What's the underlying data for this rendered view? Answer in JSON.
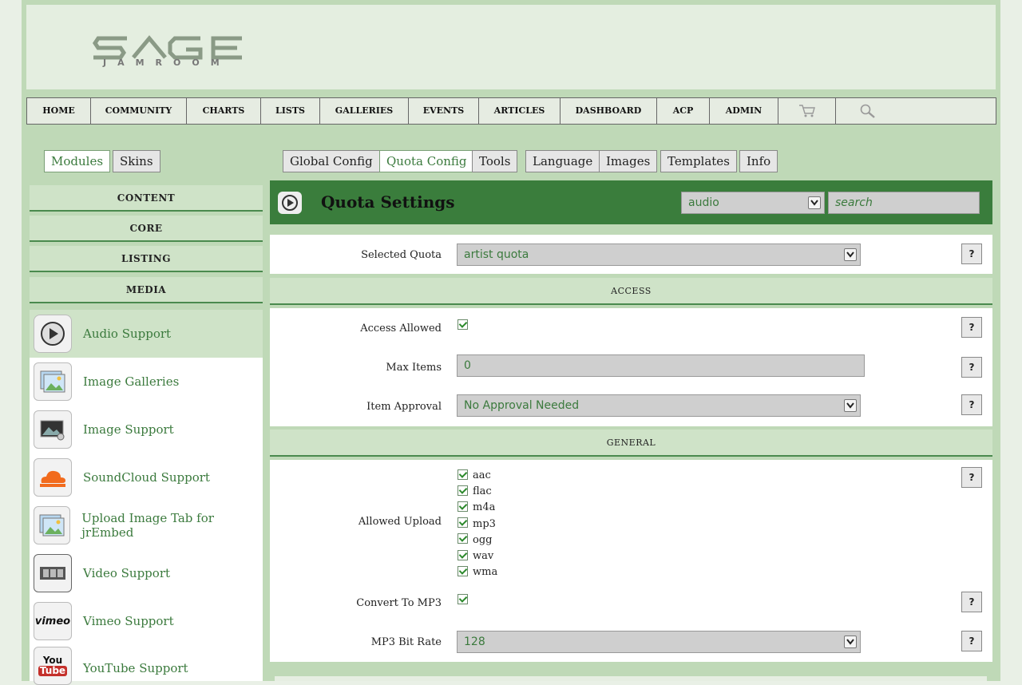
{
  "logo": {
    "text": "SAGE",
    "subtext": "JAMROOM"
  },
  "nav": {
    "items": [
      "HOME",
      "COMMUNITY",
      "CHARTS",
      "LISTS",
      "GALLERIES",
      "EVENTS",
      "ARTICLES",
      "DASHBOARD",
      "ACP",
      "ADMIN"
    ],
    "icons": [
      "cart-icon",
      "search-icon"
    ]
  },
  "sidebar_tabs": {
    "modules": "Modules",
    "skins": "Skins",
    "active": "Modules"
  },
  "main_tabs": {
    "items": [
      "Global Config",
      "Quota Config",
      "Tools",
      "Language",
      "Images",
      "Templates",
      "Info"
    ],
    "active": "Quota Config"
  },
  "sidebar": {
    "categories": [
      "CONTENT",
      "CORE",
      "LISTING",
      "MEDIA"
    ],
    "items": [
      {
        "label": "Audio Support",
        "icon": "play-icon",
        "active": true
      },
      {
        "label": "Image Galleries",
        "icon": "image-gallery-icon"
      },
      {
        "label": "Image Support",
        "icon": "image-support-icon"
      },
      {
        "label": "SoundCloud Support",
        "icon": "soundcloud-icon"
      },
      {
        "label": "Upload Image Tab for jrEmbed",
        "icon": "upload-image-icon"
      },
      {
        "label": "Video Support",
        "icon": "film-icon"
      },
      {
        "label": "Vimeo Support",
        "icon": "vimeo-icon",
        "icon_text": "vimeo"
      },
      {
        "label": "YouTube Support",
        "icon": "youtube-icon",
        "icon_text_top": "You",
        "icon_text_bottom": "Tube"
      }
    ]
  },
  "quota_panel": {
    "title": "Quota Settings",
    "module_select": "audio",
    "search_placeholder": "search",
    "selected_quota_label": "Selected Quota",
    "selected_quota_value": "artist quota",
    "help": "?",
    "sections": {
      "access": {
        "title": "ACCESS",
        "access_allowed_label": "Access Allowed",
        "access_allowed": true,
        "max_items_label": "Max Items",
        "max_items_value": "0",
        "item_approval_label": "Item Approval",
        "item_approval_value": "No Approval Needed"
      },
      "general": {
        "title": "GENERAL",
        "allowed_upload_label": "Allowed Upload",
        "allowed_upload": [
          "aac",
          "flac",
          "m4a",
          "mp3",
          "ogg",
          "wav",
          "wma"
        ],
        "convert_label": "Convert To MP3",
        "convert": true,
        "bitrate_label": "MP3 Bit Rate",
        "bitrate_value": "128"
      }
    }
  },
  "colors": {
    "accent": "#3a7d3c",
    "page_bg": "#bfd9b7",
    "link": "#3b7a3d"
  }
}
